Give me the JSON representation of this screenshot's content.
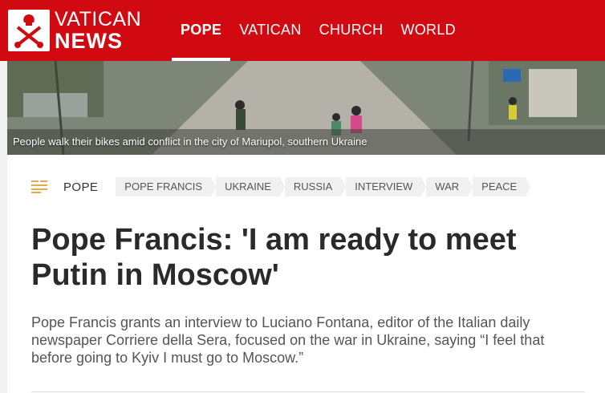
{
  "header": {
    "logo_top": "VATICAN",
    "logo_bottom": "NEWS",
    "brand_color": "#d10a11",
    "nav": [
      {
        "label": "POPE",
        "active": true
      },
      {
        "label": "VATICAN",
        "active": false
      },
      {
        "label": "CHURCH",
        "active": false
      },
      {
        "label": "WORLD",
        "active": false
      }
    ]
  },
  "hero": {
    "caption": "People walk their bikes amid conflict in the city of Mariupol, southern Ukraine"
  },
  "article": {
    "section_icon": "list-icon",
    "section": "POPE",
    "tags": [
      "POPE FRANCIS",
      "UKRAINE",
      "RUSSIA",
      "INTERVIEW",
      "WAR",
      "PEACE"
    ],
    "title": "Pope Francis: 'I am ready to meet Putin in Moscow'",
    "summary": "Pope Francis grants an interview to Luciano Fontana, editor of the Italian daily newspaper Corriere della Sera, focused on the war in Ukraine, saying “I feel that before going to Kyiv I must go to Moscow.”"
  }
}
